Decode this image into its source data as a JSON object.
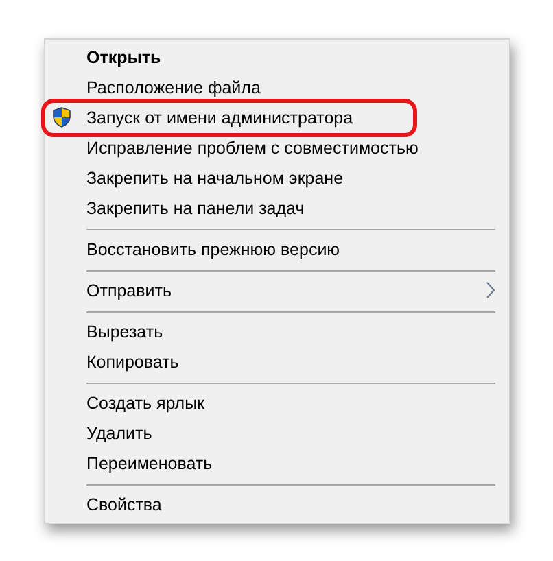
{
  "context_menu": {
    "sections": [
      [
        {
          "label": "Открыть",
          "kind": "default",
          "outlined": false
        },
        {
          "label": "Расположение файла",
          "kind": "plain",
          "outlined": false
        },
        {
          "label": "Запуск от имени администратора",
          "kind": "shield",
          "outlined": true
        },
        {
          "label": "Исправление проблем с совместимостью",
          "kind": "plain",
          "outlined": false
        },
        {
          "label": "Закрепить на начальном экране",
          "kind": "plain",
          "outlined": false
        },
        {
          "label": "Закрепить на панели задач",
          "kind": "plain",
          "outlined": false
        }
      ],
      [
        {
          "label": "Восстановить прежнюю версию",
          "kind": "plain",
          "outlined": false
        }
      ],
      [
        {
          "label": "Отправить",
          "kind": "submenu",
          "outlined": false
        }
      ],
      [
        {
          "label": "Вырезать",
          "kind": "plain",
          "outlined": false
        },
        {
          "label": "Копировать",
          "kind": "plain",
          "outlined": false
        }
      ],
      [
        {
          "label": "Создать ярлык",
          "kind": "plain",
          "outlined": false
        },
        {
          "label": "Удалить",
          "kind": "plain",
          "outlined": false
        },
        {
          "label": "Переименовать",
          "kind": "plain",
          "outlined": false
        }
      ],
      [
        {
          "label": "Свойства",
          "kind": "plain",
          "outlined": false
        }
      ]
    ]
  }
}
